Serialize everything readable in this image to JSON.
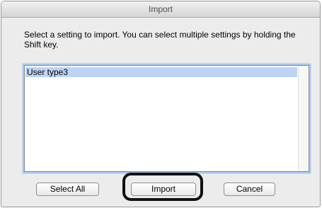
{
  "window": {
    "title": "Import"
  },
  "instruction": "Select a setting to import. You can select multiple settings by holding the Shift key.",
  "settings_list": {
    "items": [
      {
        "label": "User type3",
        "selected": true
      }
    ]
  },
  "buttons": {
    "select_all": "Select All",
    "import": "Import",
    "cancel": "Cancel"
  },
  "colors": {
    "selection_highlight": "#bdd4f5",
    "focus_ring": "#a9c7ee",
    "callout_ring": "#111111"
  }
}
